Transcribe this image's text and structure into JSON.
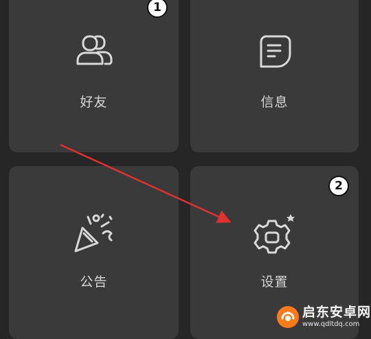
{
  "tiles": {
    "friends": {
      "label": "好友",
      "icon": "friends-icon"
    },
    "messages": {
      "label": "信息",
      "icon": "message-icon"
    },
    "announcements": {
      "label": "公告",
      "icon": "party-popper-icon"
    },
    "settings": {
      "label": "设置",
      "icon": "gear-icon"
    }
  },
  "markers": {
    "first": "1",
    "second": "2"
  },
  "annotation": {
    "arrow_color": "#e03131"
  },
  "watermark": {
    "title": "启东安卓网",
    "url": "www.qdltdq.com"
  }
}
